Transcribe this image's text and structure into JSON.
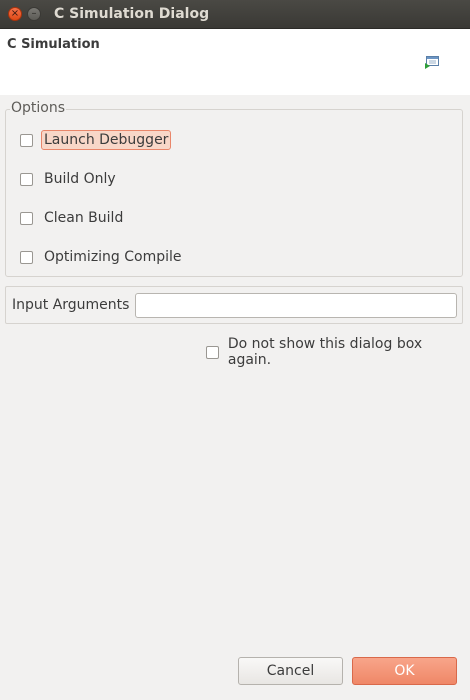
{
  "window": {
    "title": "C Simulation Dialog",
    "close_glyph": "×",
    "minimize_glyph": "–"
  },
  "header": {
    "title": "C Simulation",
    "icon": "launch-configuration-icon"
  },
  "options": {
    "group_label": "Options",
    "items": [
      {
        "label": "Launch Debugger",
        "checked": false,
        "focused": true
      },
      {
        "label": "Build Only",
        "checked": false,
        "focused": false
      },
      {
        "label": "Clean Build",
        "checked": false,
        "focused": false
      },
      {
        "label": "Optimizing Compile",
        "checked": false,
        "focused": false
      }
    ]
  },
  "input_arguments": {
    "label": "Input Arguments",
    "value": "",
    "placeholder": ""
  },
  "do_not_show": {
    "label": "Do not show this dialog box again.",
    "checked": false
  },
  "buttons": {
    "cancel": "Cancel",
    "ok": "OK"
  },
  "colors": {
    "accent": "#ef8767",
    "focus_highlight": "#f8d7c8",
    "titlebar": "#3c3b37"
  }
}
